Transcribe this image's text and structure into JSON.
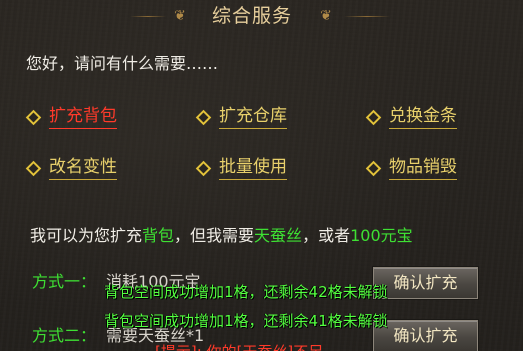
{
  "title": "综合服务",
  "greeting": "您好，请问有什么需要……",
  "options": [
    {
      "label": "扩充背包",
      "active": true
    },
    {
      "label": "扩充仓库",
      "active": false
    },
    {
      "label": "兑换金条",
      "active": false
    },
    {
      "label": "改名变性",
      "active": false
    },
    {
      "label": "批量使用",
      "active": false
    },
    {
      "label": "物品销毁",
      "active": false
    }
  ],
  "info": {
    "prefix": "我可以为您扩充",
    "item1": "背包",
    "mid": "，但我需要",
    "item2": "天蚕丝",
    "mid2": "，或者",
    "item3": "100元宝"
  },
  "methods": [
    {
      "label": "方式一：",
      "desc": "消耗100元宝",
      "button": "确认扩充"
    },
    {
      "label": "方式二：",
      "desc": "需要天蚕丝*1",
      "button": "确认扩充"
    }
  ],
  "toasts": [
    "背包空间成功增加1格，还剩余42格未解锁",
    "背包空间成功增加1格，还剩余41格未解锁"
  ],
  "warning": "[提示]: 你的[天蚕丝]不足"
}
